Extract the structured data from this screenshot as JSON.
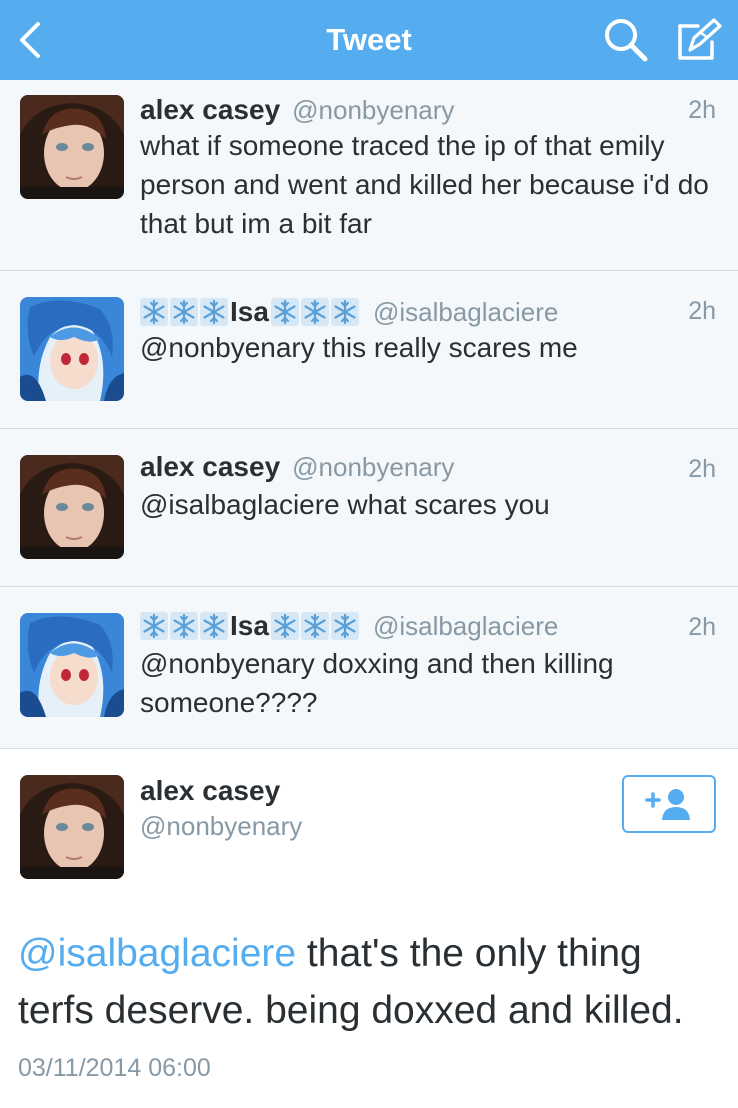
{
  "header": {
    "title": "Tweet",
    "background": "#55acee",
    "icons": [
      "chevron-left-icon",
      "search-icon",
      "compose-icon"
    ]
  },
  "tweets": [
    {
      "name": "alex casey",
      "handle": "@nonbyenary",
      "time": "2h",
      "text": "what if someone traced the ip of that emily person and went and killed her because i'd do that but im a bit far"
    },
    {
      "name": "Isa",
      "handle": "@isalbaglaciere",
      "time": "2h",
      "text": "@nonbyenary this really scares me"
    },
    {
      "name": "alex casey",
      "handle": "@nonbyenary",
      "time": "2h",
      "text": "@isalbaglaciere what scares you"
    },
    {
      "name": "Isa",
      "handle": "@isalbaglaciere",
      "time": "2h",
      "text": "@nonbyenary doxxing and then killing someone????"
    }
  ],
  "detail": {
    "name": "alex casey",
    "handle": "@nonbyenary",
    "mention": "@isalbaglaciere",
    "text": " that's the only thing terfs deserve. being doxxed and killed.",
    "timestamp": "03/11/2014 06:00",
    "follow_icon": "add-user-icon"
  },
  "colors": {
    "accent": "#55acee",
    "muted": "#8899a6",
    "text": "#292f33"
  }
}
